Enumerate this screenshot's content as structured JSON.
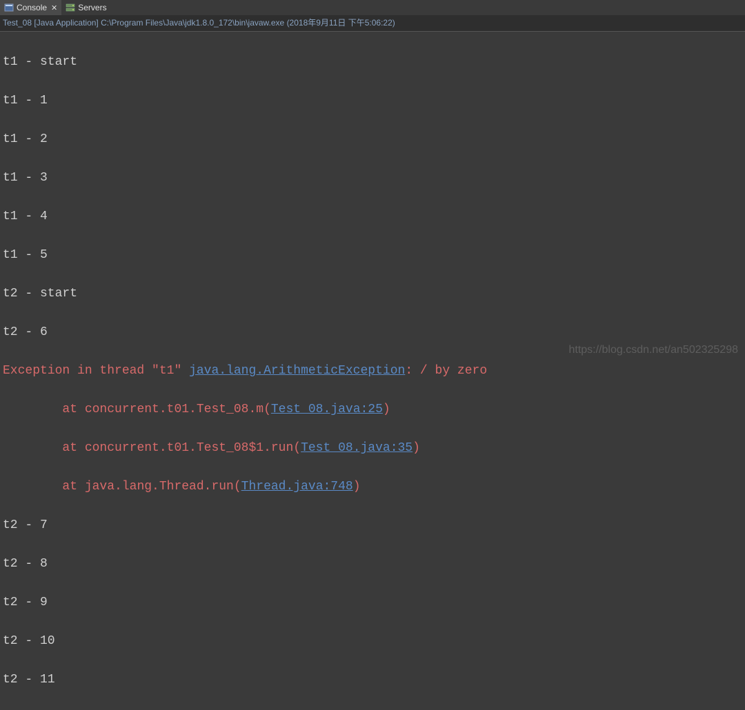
{
  "tabs": {
    "console": {
      "label": "Console"
    },
    "servers": {
      "label": "Servers"
    }
  },
  "info_bar": "Test_08 [Java Application] C:\\Program Files\\Java\\jdk1.8.0_172\\bin\\javaw.exe (2018年9月11日 下午5:06:22)",
  "output": {
    "l0": "t1 - start",
    "l1": "t1 - 1",
    "l2": "t1 - 2",
    "l3": "t1 - 3",
    "l4": "t1 - 4",
    "l5": "t1 - 5",
    "l6": "t2 - start",
    "l7": "t2 - 6",
    "ex_head_pre": "Exception in thread \"t1\" ",
    "ex_head_link": "java.lang.ArithmeticException",
    "ex_head_post": ": / by zero",
    "st0_pre": "\tat concurrent.t01.Test_08.m(",
    "st0_link": "Test_08.java:25",
    "st0_post": ")",
    "st1_pre": "\tat concurrent.t01.Test_08$1.run(",
    "st1_link": "Test_08.java:35",
    "st1_post": ")",
    "st2_pre": "\tat java.lang.Thread.run(",
    "st2_link": "Thread.java:748",
    "st2_post": ")",
    "l8": "t2 - 7",
    "l9": "t2 - 8",
    "l10": "t2 - 9",
    "l11": "t2 - 10",
    "l12": "t2 - 11"
  },
  "watermark": "https://blog.csdn.net/an502325298"
}
